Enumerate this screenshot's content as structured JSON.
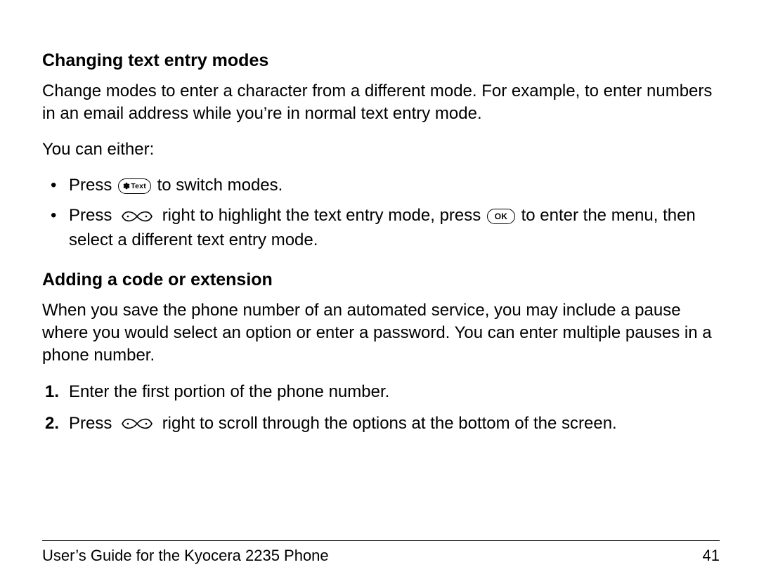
{
  "section1": {
    "heading": "Changing text entry modes",
    "intro": "Change modes to enter a character from a different mode. For example, to enter numbers in an email address while you’re in normal text entry mode.",
    "lead": "You can either:",
    "bullets": [
      {
        "pre": "Press ",
        "post": " to switch modes."
      },
      {
        "pre": "Press ",
        "mid": " right to highlight the text entry mode, press ",
        "post": " to enter the menu, then select a different text entry mode."
      }
    ]
  },
  "section2": {
    "heading": "Adding a code or extension",
    "intro": "When you save the phone number of an automated service, you may include a pause where you would select an option or enter a password. You can enter multiple pauses in a phone number.",
    "steps": [
      {
        "text": "Enter the first portion of the phone number."
      },
      {
        "pre": "Press ",
        "post": " right to scroll through the options at the bottom of the screen."
      }
    ]
  },
  "icons": {
    "text_key_star": "✽",
    "text_key_label": "Text",
    "ok_key_label": "OK"
  },
  "footer": {
    "title": "User’s Guide for the Kyocera 2235 Phone",
    "page": "41"
  }
}
